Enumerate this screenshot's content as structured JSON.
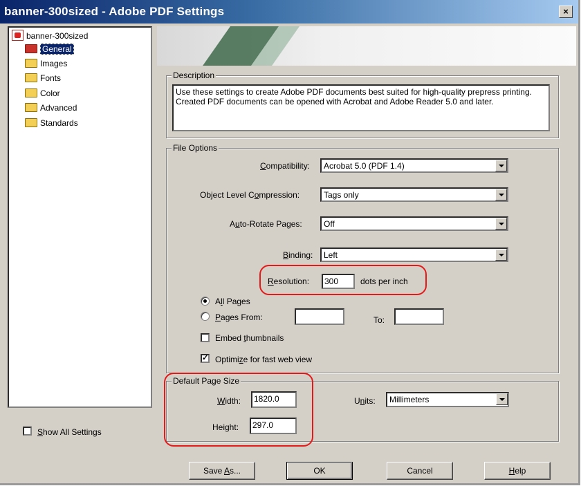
{
  "window": {
    "title": "banner-300sized - Adobe PDF Settings",
    "close_label": "×"
  },
  "tree": {
    "root": "banner-300sized",
    "items": [
      {
        "label": "General",
        "selected": true
      },
      {
        "label": "Images"
      },
      {
        "label": "Fonts"
      },
      {
        "label": "Color"
      },
      {
        "label": "Advanced"
      },
      {
        "label": "Standards"
      }
    ]
  },
  "show_all_settings": {
    "label": "Show All Settings",
    "checked": false
  },
  "description": {
    "group_label": "Description",
    "text": "Use these settings to create Adobe PDF documents best suited for high-quality prepress printing.  Created PDF documents can be opened with Acrobat and Adobe Reader 5.0 and later."
  },
  "file_options": {
    "group_label": "File Options",
    "compatibility": {
      "label": "Compatibility:",
      "value": "Acrobat 5.0 (PDF 1.4)"
    },
    "compression": {
      "label": "Object Level Compression:",
      "value": "Tags only"
    },
    "auto_rotate": {
      "label": "Auto-Rotate Pages:",
      "value": "Off"
    },
    "binding": {
      "label": "Binding:",
      "value": "Left"
    },
    "resolution": {
      "label": "Resolution:",
      "value": "300",
      "unit": "dots per inch"
    },
    "all_pages": {
      "label": "All Pages",
      "checked": true
    },
    "pages_from": {
      "label": "Pages From:",
      "from_value": "",
      "to_label": "To:",
      "to_value": ""
    },
    "embed_thumbnails": {
      "label": "Embed thumbnails",
      "checked": false
    },
    "optimize_web": {
      "label": "Optimize for fast web view",
      "checked": true
    }
  },
  "page_size": {
    "group_label": "Default Page Size",
    "width": {
      "label": "Width:",
      "value": "1820.0"
    },
    "height": {
      "label": "Height:",
      "value": "297.0"
    },
    "units": {
      "label": "Units:",
      "value": "Millimeters"
    }
  },
  "buttons": {
    "save_as": "Save As...",
    "ok": "OK",
    "cancel": "Cancel",
    "help": "Help"
  },
  "colors": {
    "highlight": "#e21a1a",
    "title_start": "#0a246a",
    "title_end": "#a6caf0",
    "dialog_bg": "#d4d0c8"
  }
}
